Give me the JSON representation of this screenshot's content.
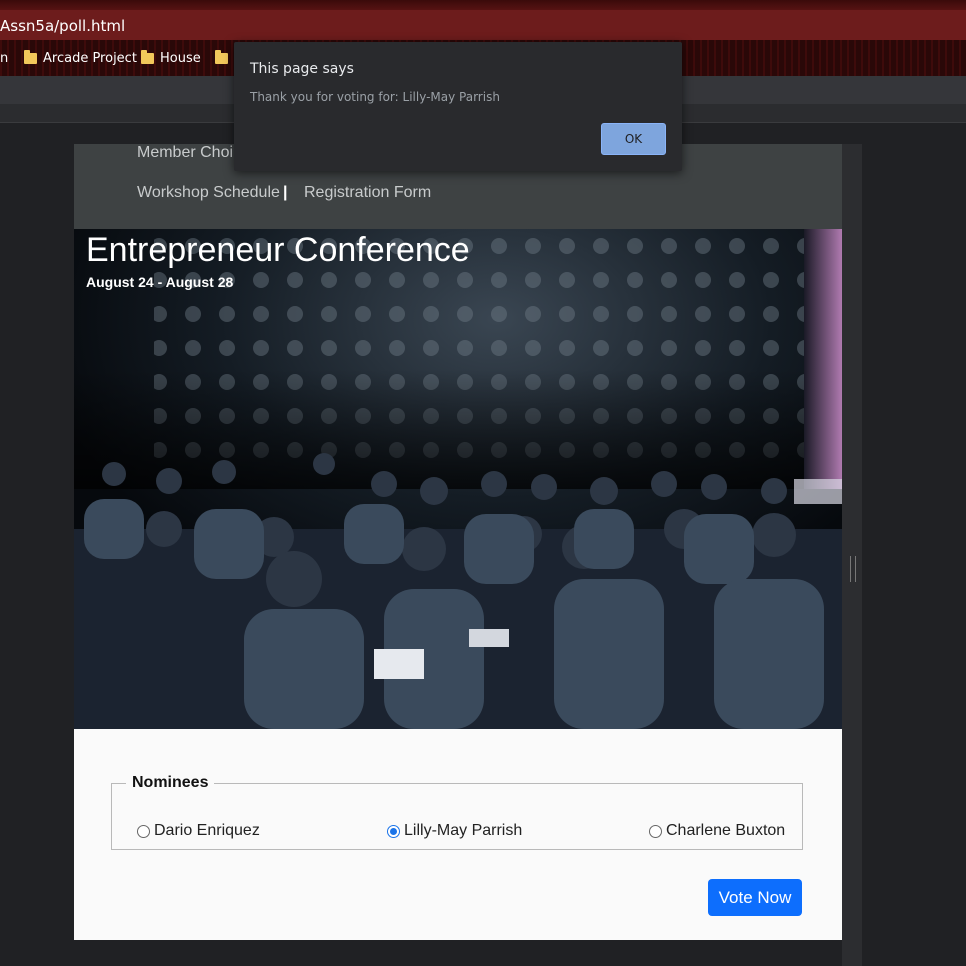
{
  "browser": {
    "url": "Assn5a/poll.html",
    "bookmarks": [
      {
        "label": "n"
      },
      {
        "label": "Arcade Project"
      },
      {
        "label": "House"
      },
      {
        "label": ""
      }
    ]
  },
  "nav": {
    "links": [
      "Member Choi",
      "Workshop Schedule",
      "|",
      "Registration Form"
    ]
  },
  "hero": {
    "title": "Entrepreneur Conference",
    "dates": "August 24 - August 28"
  },
  "poll": {
    "legend": "Nominees",
    "options": [
      {
        "label": "Dario Enriquez",
        "checked": false
      },
      {
        "label": "Lilly-May Parrish",
        "checked": true
      },
      {
        "label": "Charlene Buxton",
        "checked": false
      }
    ],
    "submit_label": "Vote Now"
  },
  "dialog": {
    "title": "This page says",
    "message": "Thank you for voting for: Lilly-May Parrish",
    "ok_label": "OK"
  },
  "colors": {
    "accent": "#0d6efd",
    "nav_bg": "#3e4243",
    "dialog_bg": "#292a2d"
  }
}
